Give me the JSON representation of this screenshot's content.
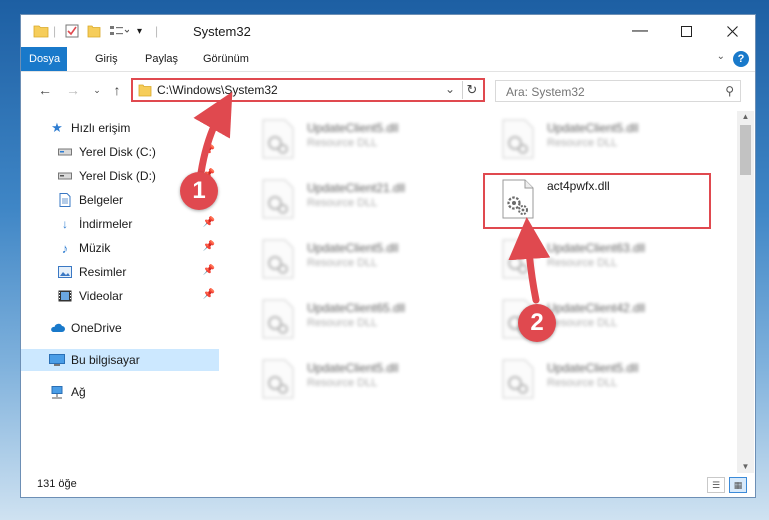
{
  "window": {
    "title": "System32"
  },
  "ribbon": {
    "tabs": [
      "Dosya",
      "Giriş",
      "Paylaş",
      "Görünüm"
    ]
  },
  "address": {
    "path": "C:\\Windows\\System32"
  },
  "search": {
    "placeholder": "Ara: System32"
  },
  "nav": {
    "items": [
      {
        "label": "Hızlı erişim",
        "icon": "star-icon"
      },
      {
        "label": "Yerel Disk (C:)",
        "icon": "drive-icon"
      },
      {
        "label": "Yerel Disk (D:)",
        "icon": "drive-icon"
      },
      {
        "label": "Belgeler",
        "icon": "documents-icon"
      },
      {
        "label": "İndirmeler",
        "icon": "download-icon"
      },
      {
        "label": "Müzik",
        "icon": "music-icon"
      },
      {
        "label": "Resimler",
        "icon": "pictures-icon"
      },
      {
        "label": "Videolar",
        "icon": "videos-icon"
      },
      {
        "label": "OneDrive",
        "icon": "cloud-icon"
      },
      {
        "label": "Bu bilgisayar",
        "icon": "computer-icon"
      },
      {
        "label": "Ağ",
        "icon": "network-icon"
      }
    ]
  },
  "files": [
    {
      "name": "UpdateClient5.dll",
      "type": "Resource DLL"
    },
    {
      "name": "UpdateClient5.dll",
      "type": "Resource DLL"
    },
    {
      "name": "UpdateClient21.dll",
      "type": "Resource DLL"
    },
    {
      "name": "act4pwfx.dll",
      "type": ""
    },
    {
      "name": "UpdateClient5.dll",
      "type": "Resource DLL"
    },
    {
      "name": "UpdateClient63.dll",
      "type": "Resource DLL"
    },
    {
      "name": "UpdateClient65.dll",
      "type": "Resource DLL"
    },
    {
      "name": "UpdateClient42.dll",
      "type": "Resource DLL"
    },
    {
      "name": "UpdateClient5.dll",
      "type": "Resource DLL"
    },
    {
      "name": "UpdateClient5.dll",
      "type": "Resource DLL"
    }
  ],
  "status": {
    "count": "131 öğe"
  },
  "annotations": {
    "badge1": "1",
    "badge2": "2"
  },
  "colors": {
    "accent": "#1979ca",
    "highlight": "#e0494f",
    "selected": "#cce8ff"
  }
}
